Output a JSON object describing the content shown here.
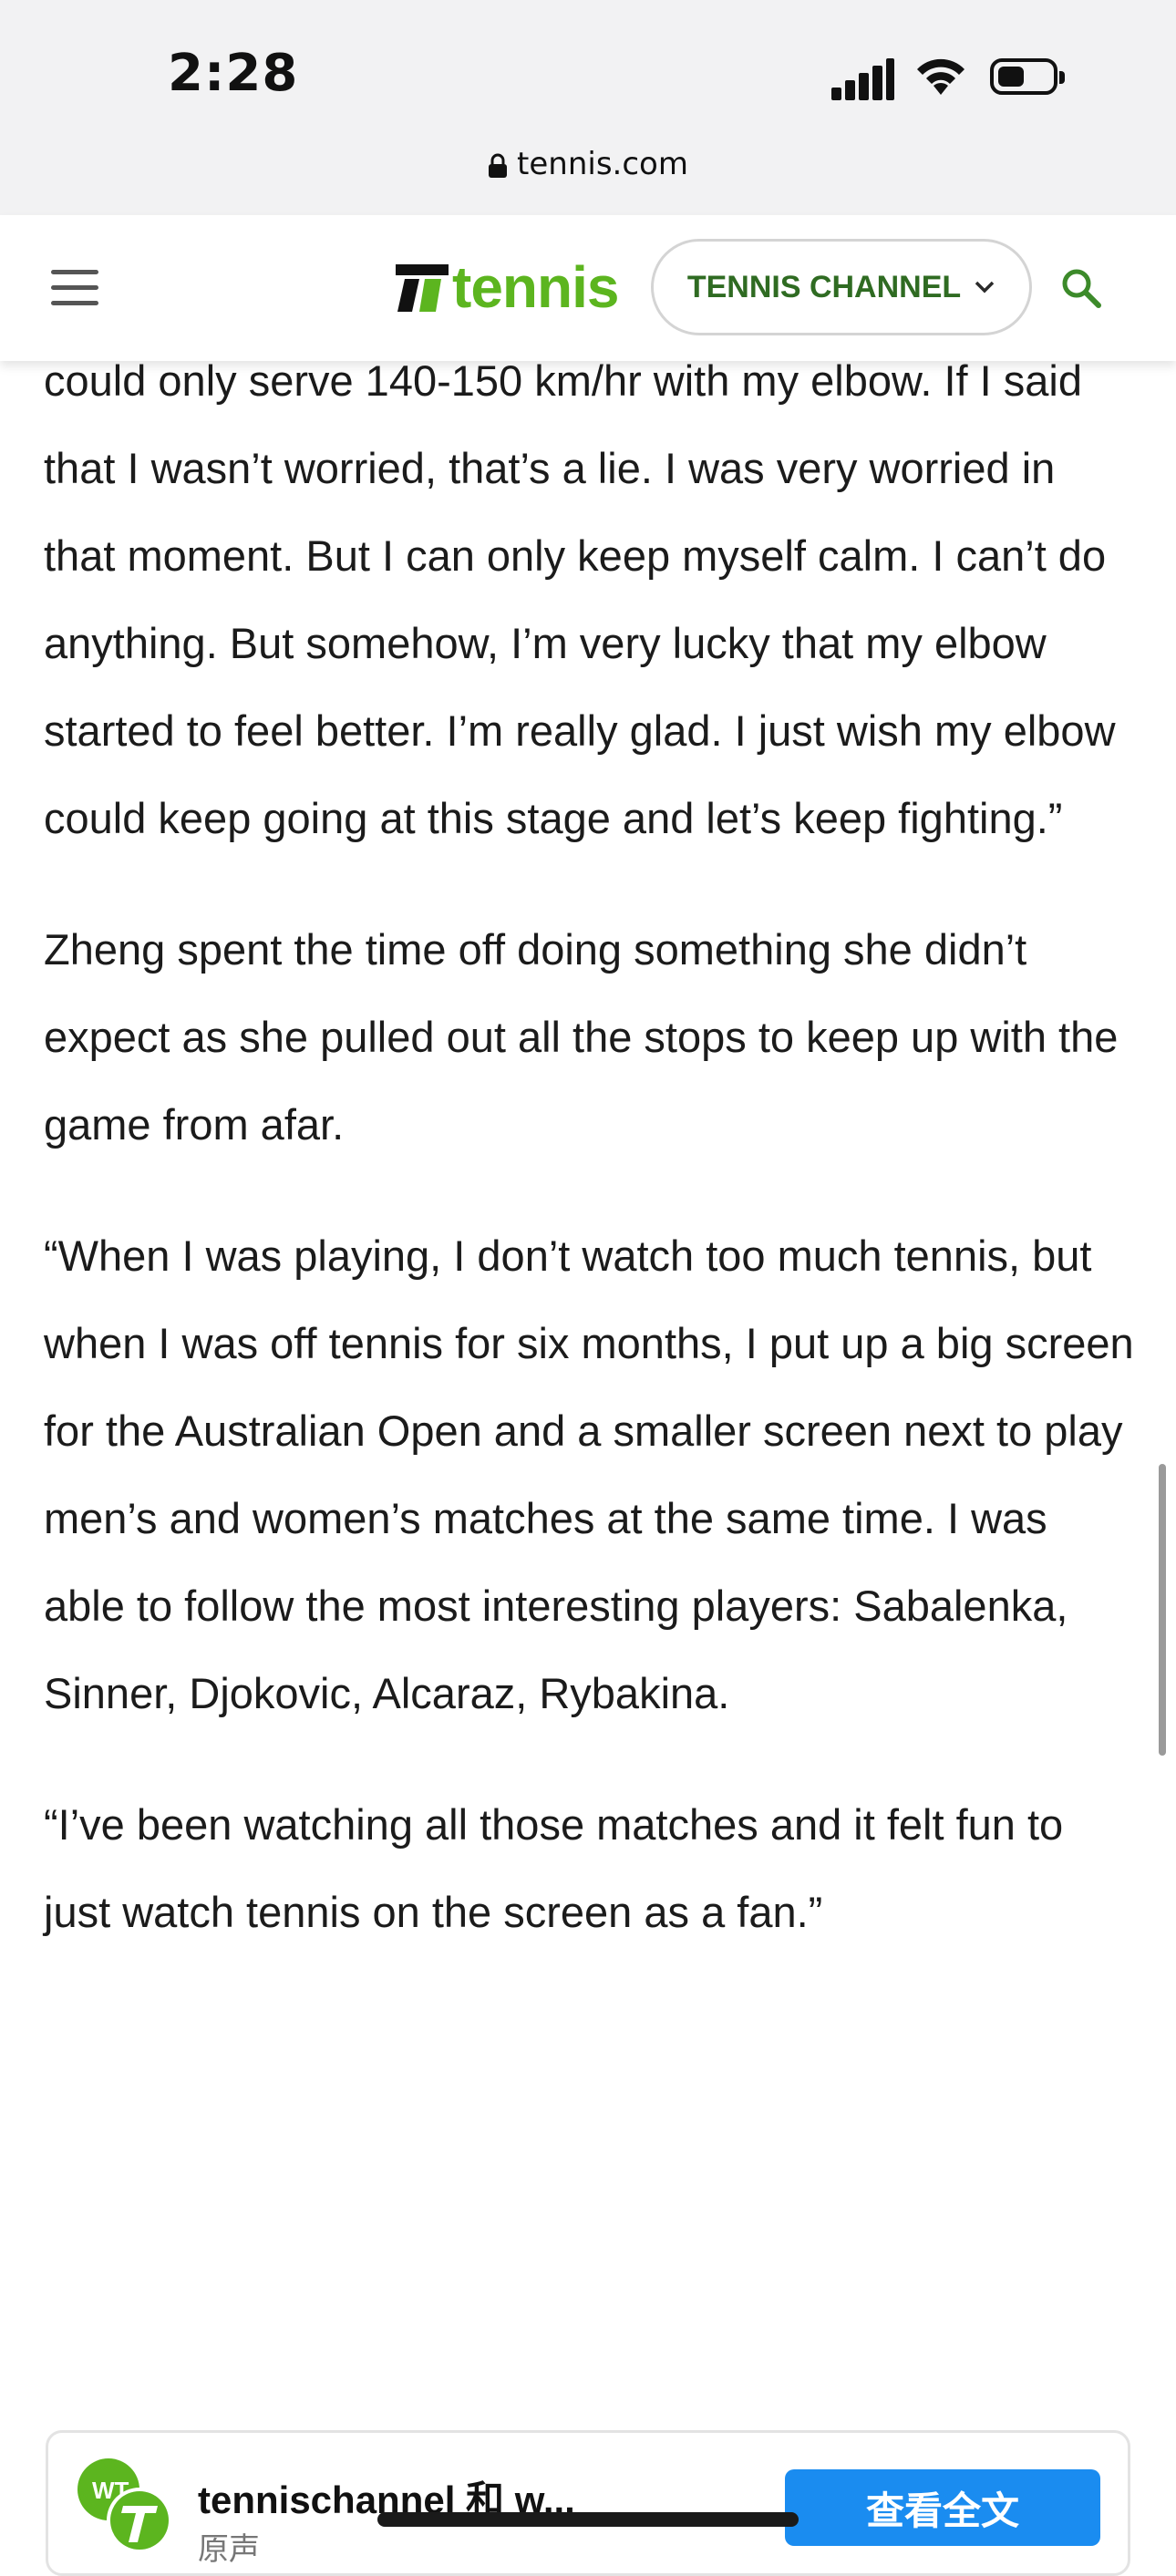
{
  "status_bar": {
    "time": "2:28",
    "url": "tennis.com"
  },
  "header": {
    "logo_text": "tennis",
    "channel_button": "TENNIS CHANNEL",
    "brand_color": "#5cb51f"
  },
  "article": {
    "paragraphs": [
      "could only serve 140-150 km/hr with my elbow. If I said that I wasn’t worried, that’s a lie. I was very worried in that moment. But I can only keep myself calm. I can’t do anything. But somehow, I’m very lucky that my elbow started to feel better. I’m really glad. I just wish my elbow could keep going at this stage and let’s keep fighting.”",
      "Zheng spent the time off doing something she didn’t expect as she pulled out all the stops to keep up with the game from afar.",
      "“When I was playing, I don’t watch too much tennis, but when I was off tennis for six months, I put up a big screen for the Australian Open and a smaller screen next to play men’s and women’s matches at the same time. I was able to follow the most interesting players: Sabalenka, Sinner, Djokovic, Alcaraz, Rybakina.",
      "“I’ve been watching all those matches and it felt fun to just watch tennis on the screen as a fan.”"
    ]
  },
  "app_card": {
    "title": "tennischannel 和 w...",
    "subtitle": "原声",
    "button": "查看全文",
    "button_color": "#1a8cf0"
  }
}
